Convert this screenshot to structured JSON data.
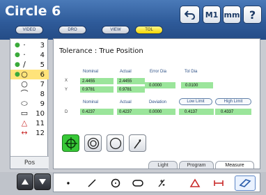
{
  "app": {
    "title": "Circle 6"
  },
  "topbar": {
    "undo_icon": "undo-icon",
    "m1_label": "M1",
    "mm_label": "mm",
    "help_label": "?"
  },
  "modes": [
    {
      "label": "VIDEO",
      "active": false
    },
    {
      "label": "DRO",
      "active": false
    },
    {
      "label": "VIEW",
      "active": false
    },
    {
      "label": "TOL",
      "active": true
    }
  ],
  "features": [
    {
      "num": "3",
      "icon": "point-icon",
      "glyph": "·",
      "dot": true,
      "selected": false
    },
    {
      "num": "4",
      "icon": "point-icon",
      "glyph": "·",
      "dot": true,
      "selected": false
    },
    {
      "num": "5",
      "icon": "line-icon",
      "glyph": "∕",
      "dot": true,
      "selected": false
    },
    {
      "num": "6",
      "icon": "circle-icon",
      "glyph": "○",
      "dot": true,
      "selected": true
    },
    {
      "num": "7",
      "icon": "circle-icon",
      "glyph": "○",
      "dot": false,
      "selected": false
    },
    {
      "num": "8",
      "icon": "arc-icon",
      "glyph": "⌒",
      "dot": false,
      "selected": false
    },
    {
      "num": "9",
      "icon": "slot-icon",
      "glyph": "⬭",
      "dot": false,
      "selected": false
    },
    {
      "num": "10",
      "icon": "rectangle-icon",
      "glyph": "▭",
      "dot": false,
      "selected": false
    },
    {
      "num": "11",
      "icon": "angle-icon",
      "glyph": "△",
      "dot": false,
      "selected": false
    },
    {
      "num": "12",
      "icon": "distance-icon",
      "glyph": "↔",
      "dot": false,
      "selected": false
    }
  ],
  "position_label": "Pos",
  "tolerance": {
    "heading": "Tolerance : True Position",
    "headers1": {
      "nominal": "Nominal",
      "actual": "Actual",
      "error_dia": "Error Dia",
      "tol_dia": "Tol Dia"
    },
    "x": {
      "label": "X",
      "nominal": "2.4455",
      "actual": "2.4455"
    },
    "y": {
      "label": "Y",
      "nominal": "0.9781",
      "actual": "0.9781"
    },
    "error_dia": "0.0000",
    "tol_dia": "0.0100",
    "headers2": {
      "nominal": "Nominal",
      "actual": "Actual",
      "deviation": "Deviation",
      "low_limit": "Low Limit",
      "high_limit": "High Limit"
    },
    "d": {
      "label": "D",
      "nominal": "0.4237",
      "actual": "0.4237",
      "deviation": "0.0000",
      "low_limit": "0.4137",
      "high_limit": "0.4337"
    }
  },
  "tol_buttons": [
    {
      "name": "true-position-button",
      "icon": "crosshair-circle-icon",
      "active": true
    },
    {
      "name": "concentricity-button",
      "icon": "concentric-circles-icon",
      "active": false
    },
    {
      "name": "circularity-button",
      "icon": "circle-icon",
      "active": false
    },
    {
      "name": "runout-button",
      "icon": "runout-arrow-icon",
      "active": false
    }
  ],
  "tabs": [
    {
      "label": "Light",
      "active": false
    },
    {
      "label": "Program",
      "active": false
    },
    {
      "label": "Measure",
      "active": true
    }
  ],
  "measure_tools": [
    {
      "name": "point-tool",
      "icon": "point-icon"
    },
    {
      "name": "line-tool",
      "icon": "line-icon"
    },
    {
      "name": "circle-tool",
      "icon": "circle-icon"
    },
    {
      "name": "slot-tool",
      "icon": "slot-icon"
    },
    {
      "name": "blob-tool",
      "icon": "blob-icon"
    },
    {
      "name": "angle-tool",
      "icon": "angle-icon"
    },
    {
      "name": "distance-tool",
      "icon": "distance-icon"
    },
    {
      "name": "skew-tool",
      "icon": "skew-icon"
    }
  ],
  "colors": {
    "accent": "#2f5b9a",
    "highlight": "#ffe37a",
    "value_fill": "#9be59b",
    "active_tool": "#37c837"
  }
}
